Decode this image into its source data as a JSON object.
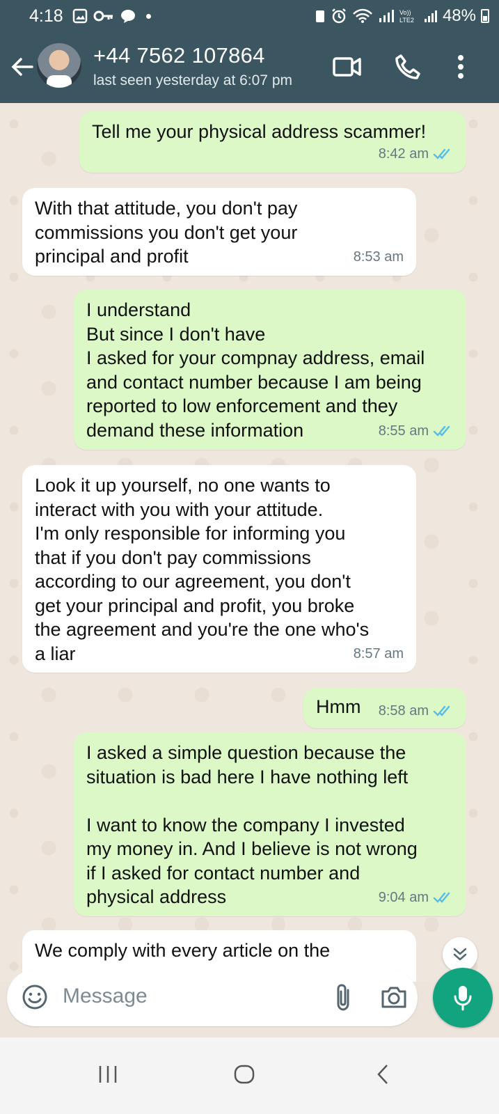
{
  "status_bar": {
    "time": "4:18",
    "battery": "48%"
  },
  "header": {
    "contact_name": "+44 7562 107864",
    "last_seen": "last seen yesterday at 6:07 pm"
  },
  "messages": [
    {
      "direction": "out",
      "text": "Tell me your physical address scammer!",
      "time": "8:42 am",
      "read": true
    },
    {
      "direction": "in",
      "text": "With that attitude, you don't pay\ncommissions you don't get your\nprincipal and profit",
      "time": "8:53 am"
    },
    {
      "direction": "out",
      "text": "I understand\nBut since I don't have\nI asked for your compnay address, email\nand contact number because I am being\nreported to low enforcement and they\ndemand these information",
      "time": "8:55 am",
      "read": true
    },
    {
      "direction": "in",
      "text": "Look it up yourself, no one wants to\ninteract with you with your attitude.\nI'm only responsible for informing you\nthat if you don't pay commissions\naccording to our agreement, you don't\nget your principal and profit, you broke\nthe agreement and you're the one who's\na liar",
      "time": "8:57 am"
    },
    {
      "direction": "out",
      "text": "Hmm",
      "time": "8:58 am",
      "read": true
    },
    {
      "direction": "out",
      "text": "I asked a simple question because the\nsituation is bad here I have nothing left\n\nI want to know the company I invested\nmy money in. And I believe is not wrong\nif I asked for contact number and\nphysical address",
      "time": "9:04 am",
      "read": true
    },
    {
      "direction": "in",
      "text": "We comply with every article on the",
      "time": ""
    }
  ],
  "composer": {
    "placeholder": "Message"
  },
  "colors": {
    "header_bg": "#3b5561",
    "outgoing_bubble": "#dcf8c6",
    "incoming_bubble": "#ffffff",
    "mic_button": "#12a37f",
    "read_ticks": "#53bdeb"
  },
  "icons": [
    "back-arrow-icon",
    "video-call-icon",
    "phone-icon",
    "more-vert-icon",
    "emoji-icon",
    "attach-icon",
    "camera-icon",
    "mic-icon",
    "double-chevron-down-icon",
    "double-check-icon"
  ]
}
